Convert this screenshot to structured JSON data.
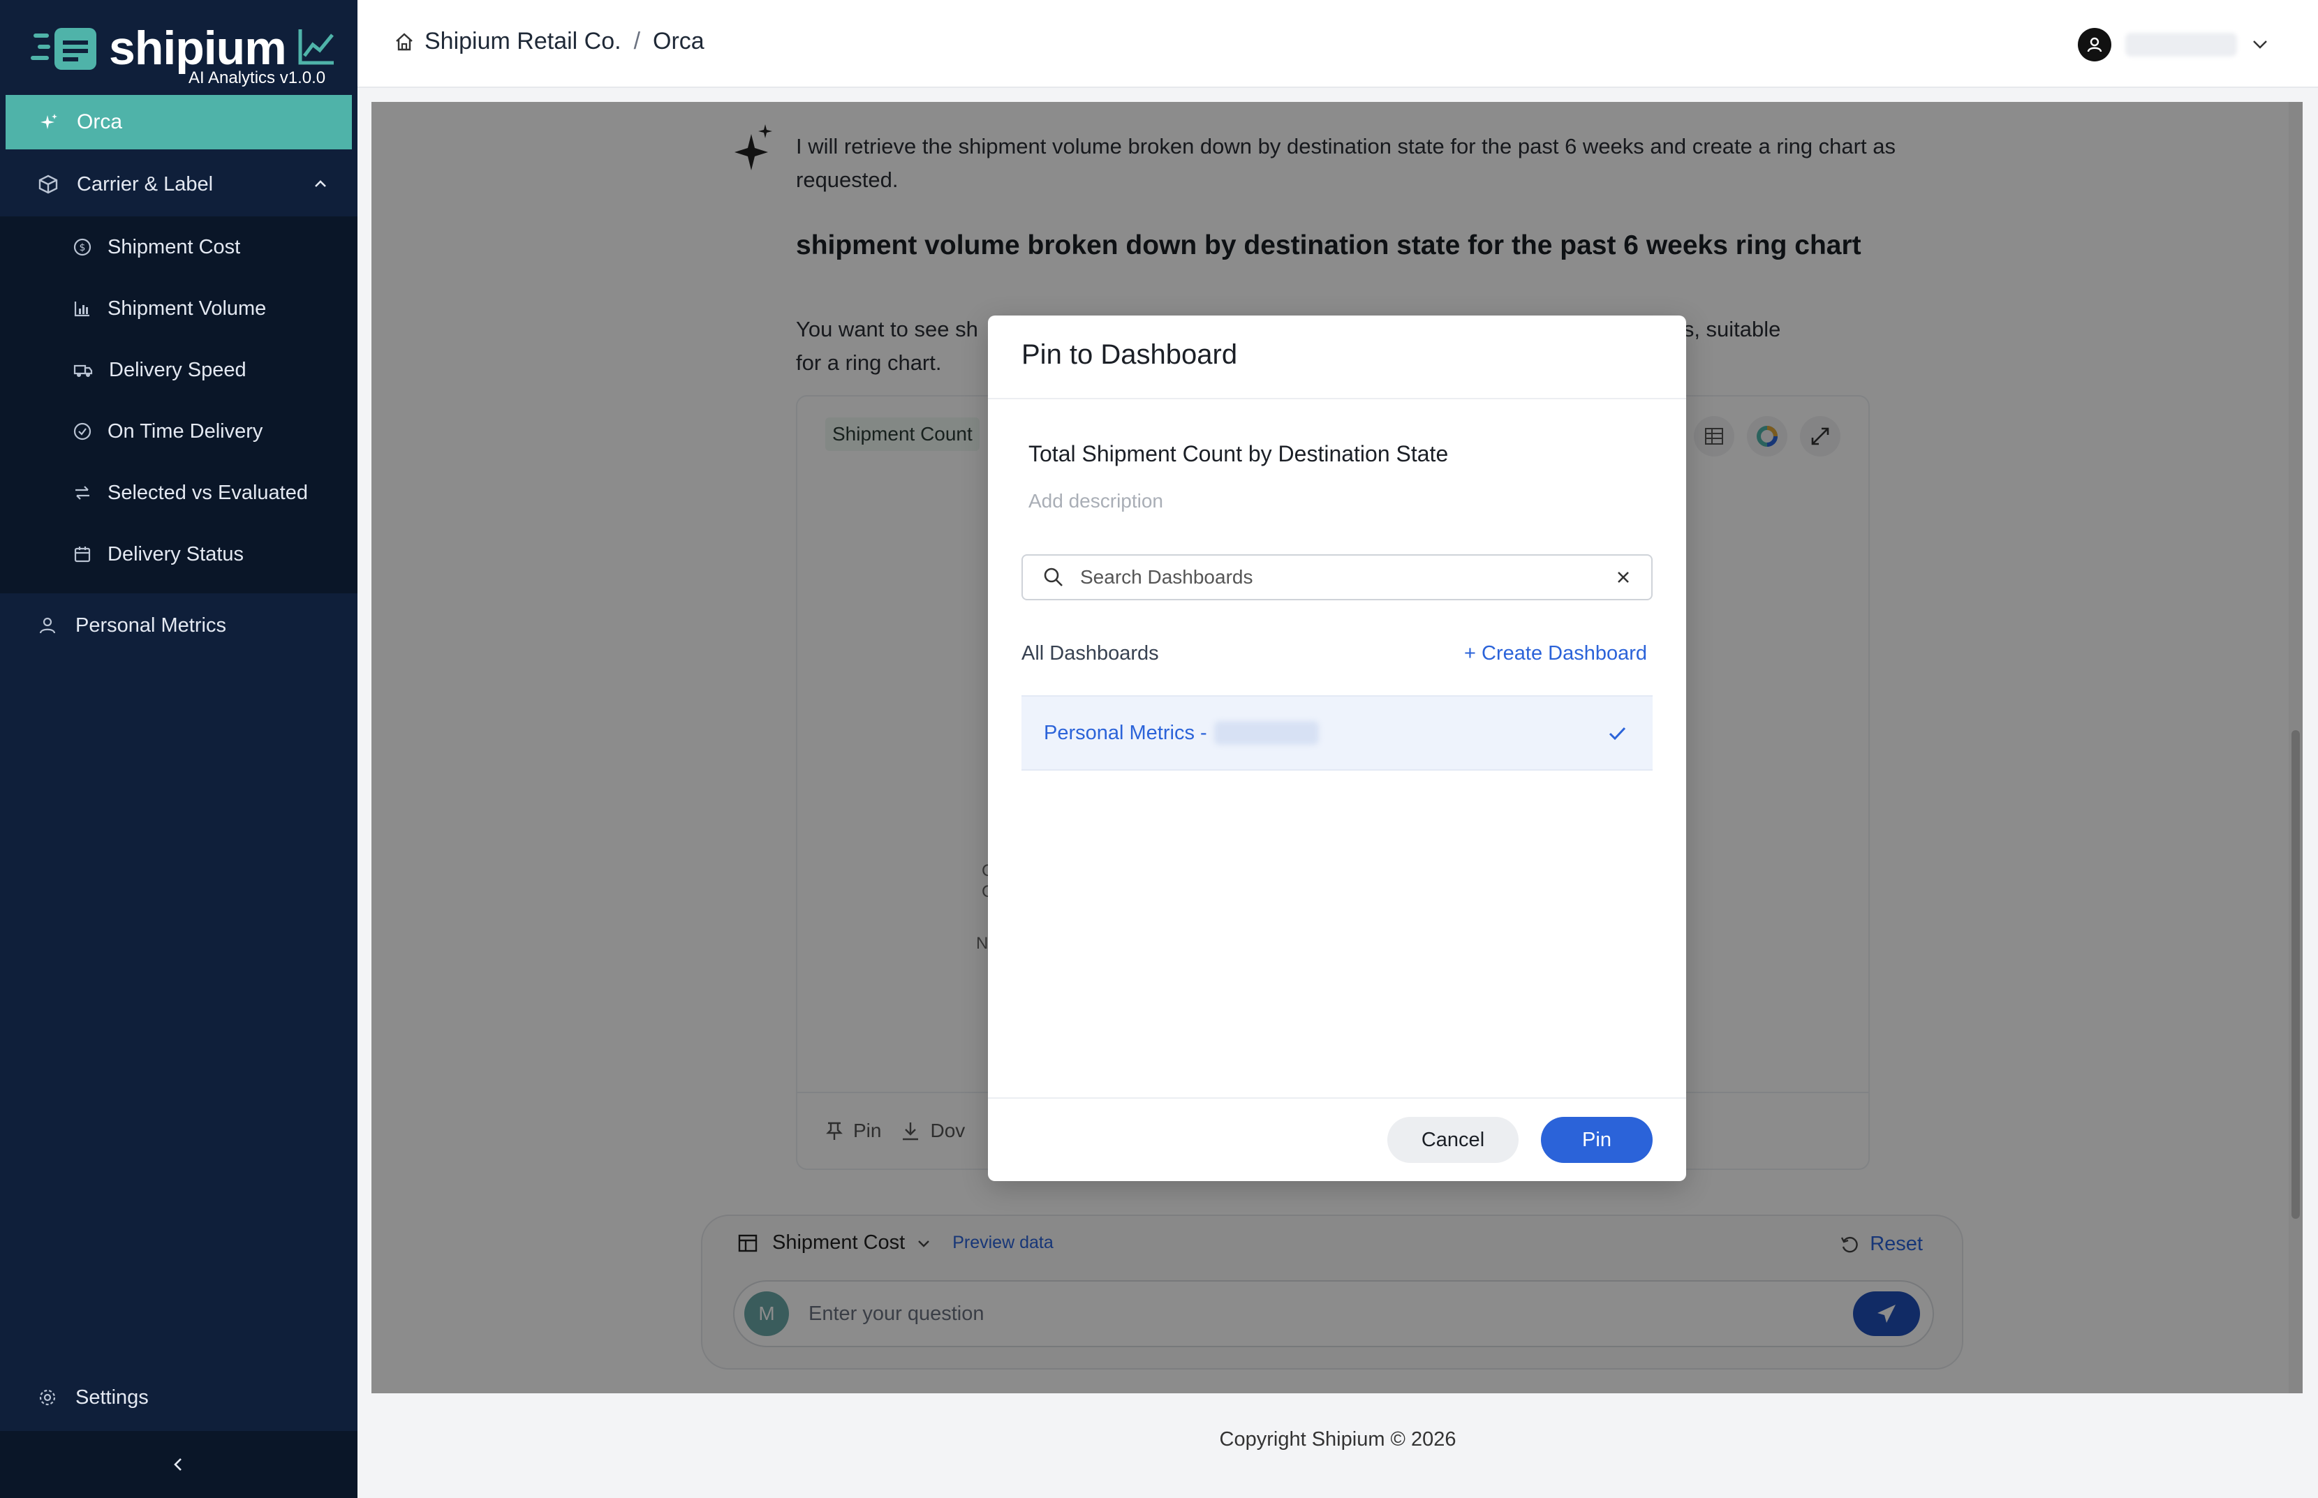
{
  "brand": {
    "name": "shipium",
    "version": "AI Analytics v1.0.0"
  },
  "sidebar": {
    "orca": "Orca",
    "carrier_group": "Carrier & Label",
    "sub_items": [
      {
        "label": "Shipment Cost",
        "icon": "dollar-circle-icon"
      },
      {
        "label": "Shipment Volume",
        "icon": "bar-chart-icon"
      },
      {
        "label": "Delivery Speed",
        "icon": "truck-icon"
      },
      {
        "label": "On Time Delivery",
        "icon": "check-circle-icon"
      },
      {
        "label": "Selected vs Evaluated",
        "icon": "compare-arrows-icon"
      },
      {
        "label": "Delivery Status",
        "icon": "calendar-icon"
      }
    ],
    "personal": "Personal Metrics",
    "settings": "Settings"
  },
  "header": {
    "breadcrumb_root": "Shipium Retail Co.",
    "breadcrumb_sep": "/",
    "breadcrumb_current": "Orca"
  },
  "chat": {
    "message": "I will retrieve the shipment volume broken down by destination state for the past 6 weeks and create a ring chart as requested.",
    "title": "shipment volume broken down by destination state for the past 6 weeks ring chart",
    "subtitle_start": "You want to see sh",
    "subtitle_end": "s, suitable",
    "subtitle_line2": "for a ring chart.",
    "chip": "Shipment Count",
    "ghost_left_1": "C",
    "ghost_left_2": "C",
    "ghost_left_3": "N'",
    "ghost_right": ")",
    "footer_pin": "Pin",
    "footer_download": "Dov"
  },
  "composer": {
    "dataset": "Shipment Cost",
    "preview": "Preview data",
    "reset": "Reset",
    "avatar_initial": "M",
    "placeholder": "Enter your question"
  },
  "modal": {
    "title": "Pin to Dashboard",
    "chart_name": "Total Shipment Count by Destination State",
    "description_placeholder": "Add description",
    "search_placeholder": "Search Dashboards",
    "list_header": "All Dashboards",
    "create_link": "+ Create Dashboard",
    "dashboards": [
      {
        "name": "Personal Metrics -",
        "selected": true
      }
    ],
    "cancel": "Cancel",
    "pin": "Pin"
  },
  "footer": {
    "copyright": "Copyright Shipium © 2026"
  },
  "colors": {
    "sidebar_bg": "#0f1f3a",
    "accent_teal": "#4fb3a9",
    "primary_blue": "#2b63d9"
  }
}
